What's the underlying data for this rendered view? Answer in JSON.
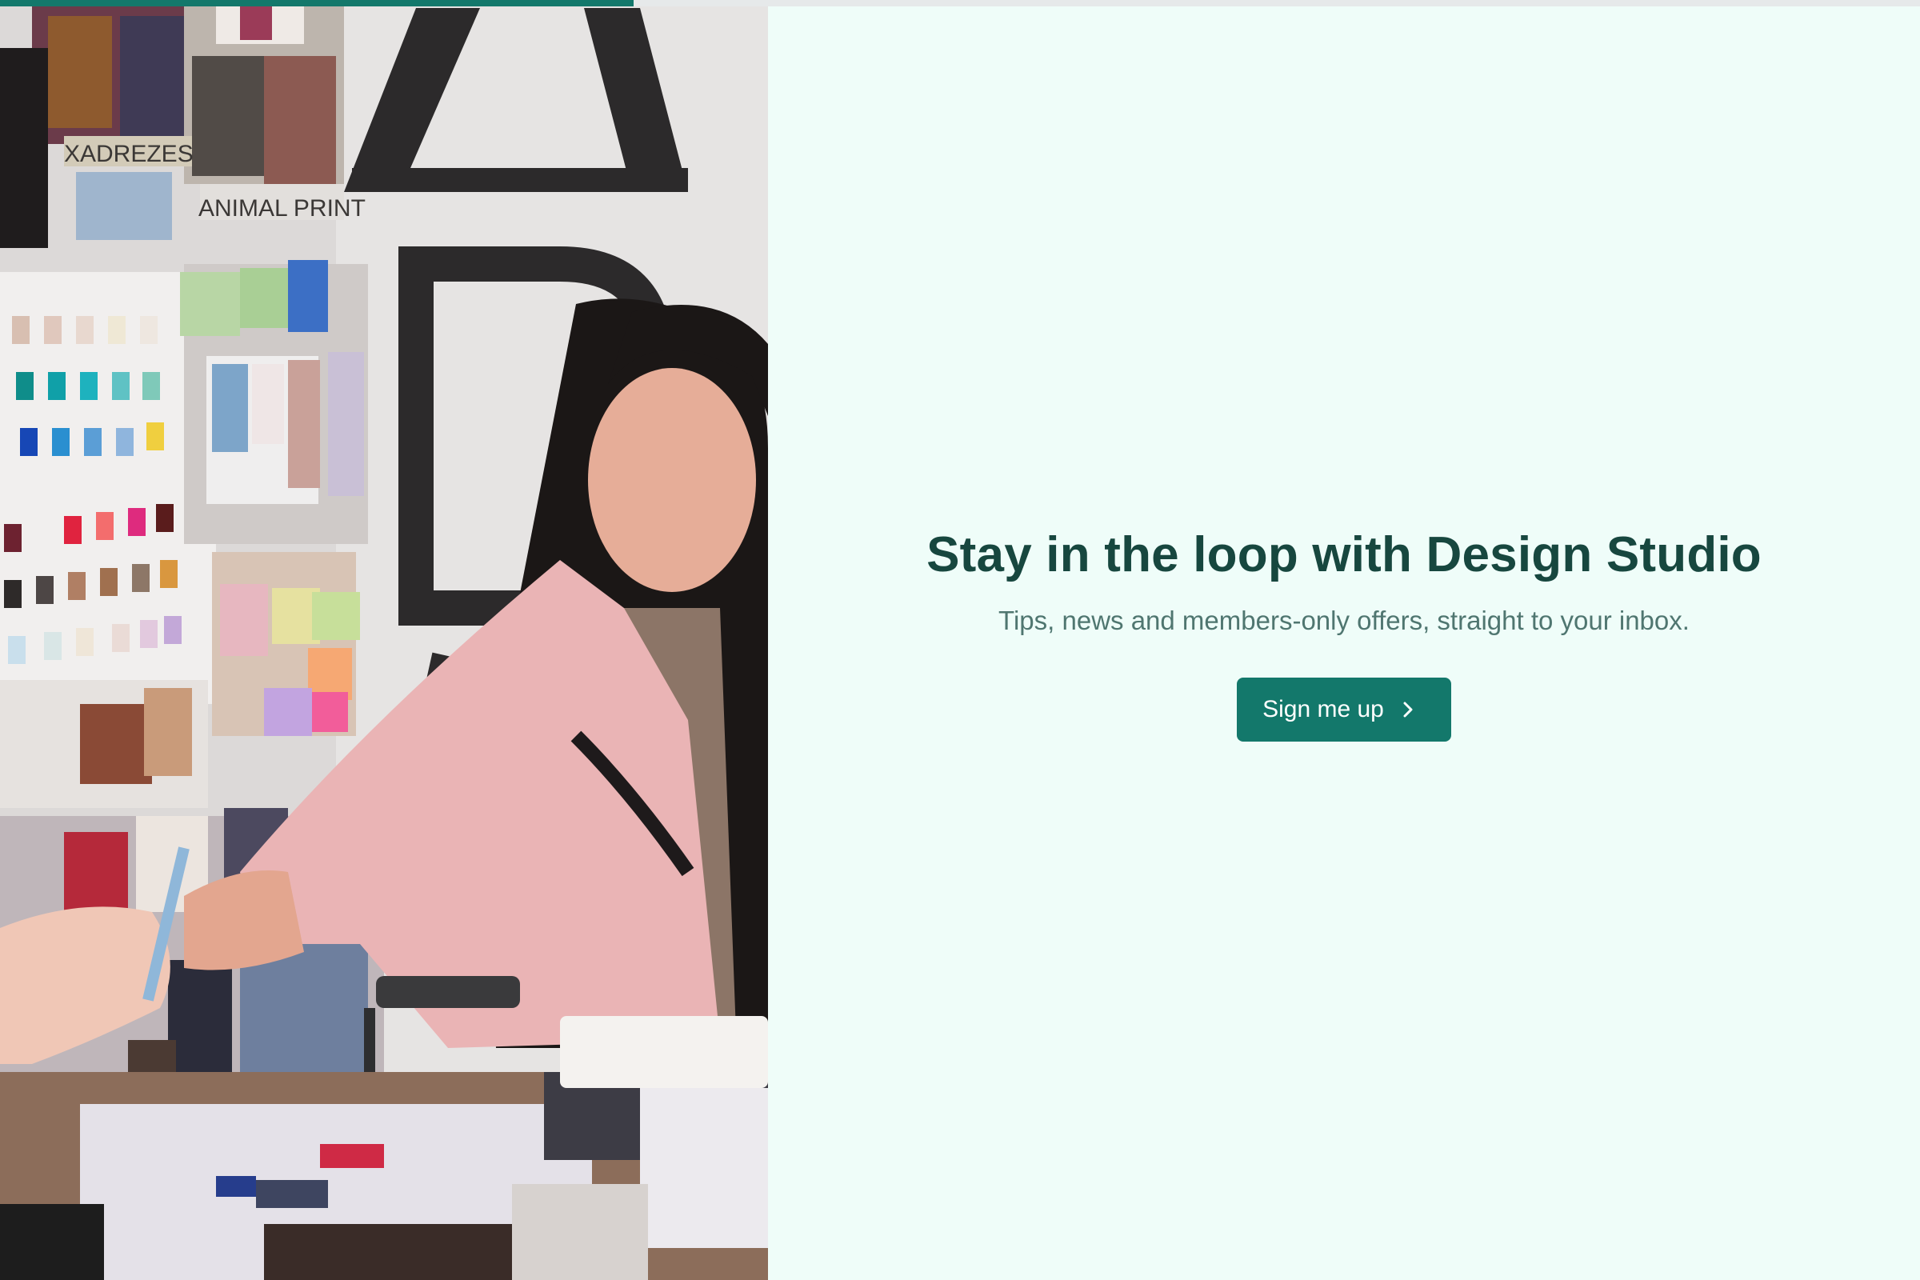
{
  "progress": {
    "percent": 33,
    "color": "#13786b"
  },
  "hero_image": {
    "description_icon": "photo-designer-moodboard",
    "wall_labels": [
      "XADREZES",
      "ANIMAL PRINT"
    ]
  },
  "signup": {
    "title": "Stay in the loop with Design Studio",
    "subtitle": "Tips, news and members-only offers, straight to your inbox.",
    "button_label": "Sign me up",
    "button_icon": "chevron-right-icon"
  },
  "colors": {
    "accent": "#13786b",
    "title": "#17473f",
    "subtitle": "#4f7670",
    "background": "#effdf9"
  }
}
